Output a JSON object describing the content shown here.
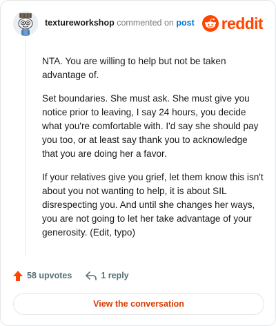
{
  "comment": {
    "username": "textureworkshop",
    "action_text": "commented on",
    "post_link": "post",
    "body": [
      "NTA. You are willing to help but not be taken advantage of.",
      "Set boundaries. She must ask. She must give you notice prior to leaving, I say 24 hours, you decide what you're comfortable with. I'd say she should pay you too, or at least say thank you to acknowledge that you are doing her a favor.",
      "If your relatives give you grief, let them know this isn't about you not wanting to help, it is about SIL disrespecting you. And until she changes her ways, you are not going to let her take advantage of your generosity. (Edit, typo)"
    ],
    "upvotes": "58 upvotes",
    "replies": "1 reply"
  },
  "brand": {
    "name": "reddit",
    "color": "#ff4500"
  },
  "cta": {
    "label": "View the conversation"
  }
}
